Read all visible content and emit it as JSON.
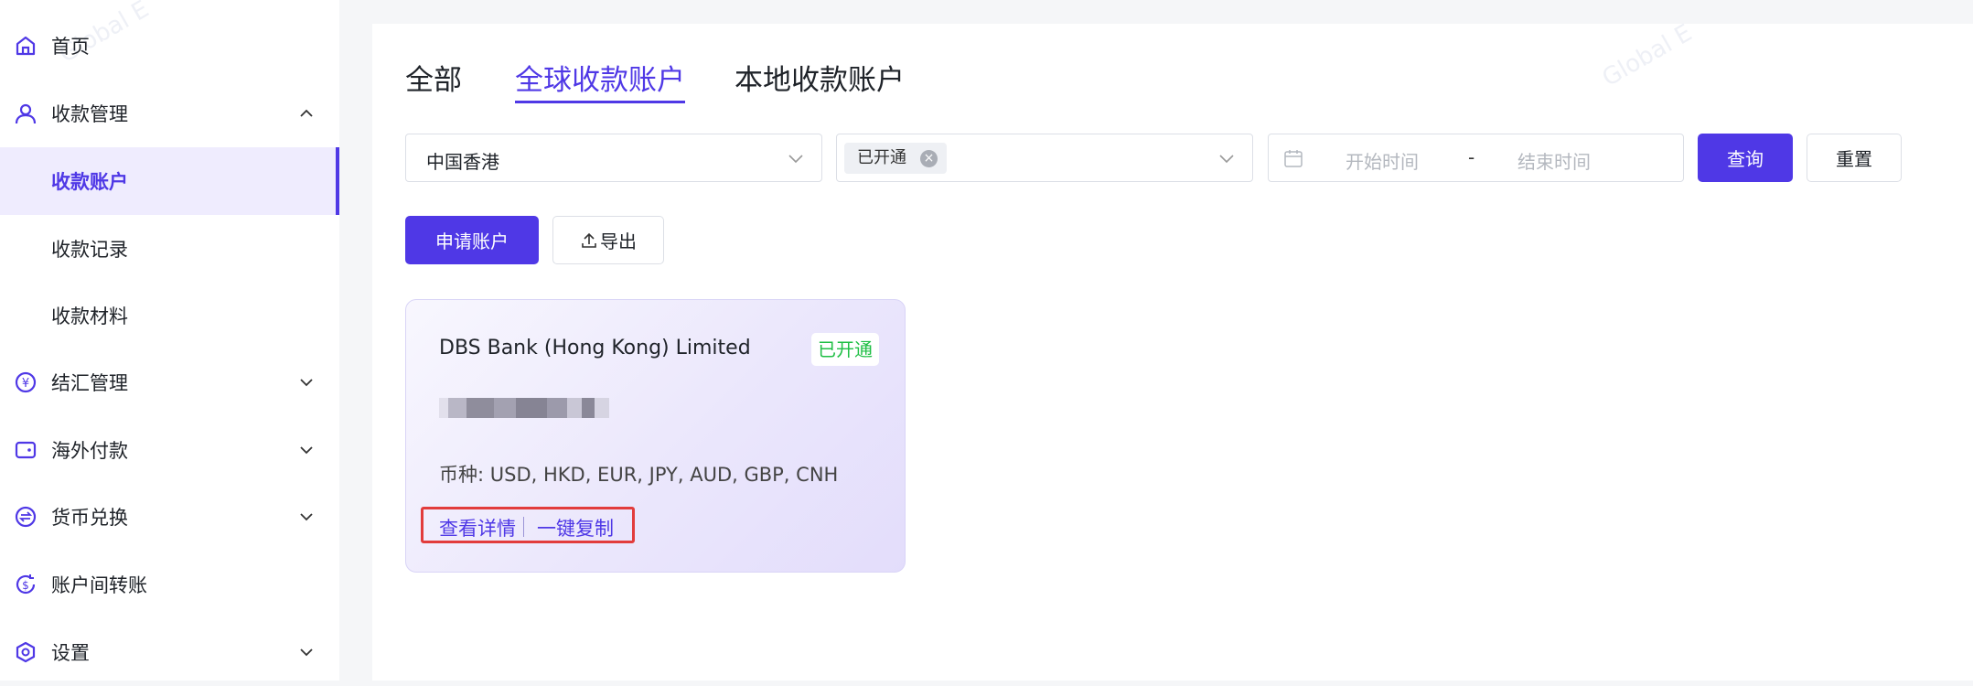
{
  "sidebar": {
    "items": [
      {
        "label": "首页",
        "icon": "home-icon"
      },
      {
        "label": "收款管理",
        "icon": "user-icon",
        "expanded": true
      },
      {
        "label": "收款账户",
        "active": true
      },
      {
        "label": "收款记录"
      },
      {
        "label": "收款材料"
      },
      {
        "label": "结汇管理",
        "icon": "yen-circle-icon"
      },
      {
        "label": "海外付款",
        "icon": "wallet-icon"
      },
      {
        "label": "货币兑换",
        "icon": "exchange-icon"
      },
      {
        "label": "账户间转账",
        "icon": "dollar-transfer-icon"
      },
      {
        "label": "设置",
        "icon": "settings-hex-icon"
      }
    ]
  },
  "tabs": [
    {
      "label": "全部"
    },
    {
      "label": "全球收款账户",
      "active": true
    },
    {
      "label": "本地收款账户"
    }
  ],
  "filters": {
    "region_value": "中国香港",
    "status_tag": "已开通",
    "start_placeholder": "开始时间",
    "separator": "-",
    "end_placeholder": "结束时间",
    "query_label": "查询",
    "reset_label": "重置"
  },
  "actions": {
    "apply_label": "申请账户",
    "export_label": "导出"
  },
  "account_card": {
    "bank_name": "DBS Bank (Hong Kong) Limited",
    "status": "已开通",
    "currency": "币种: USD, HKD, EUR, JPY, AUD, GBP, CNH",
    "view_details": "查看详情",
    "copy": "一键复制"
  },
  "watermark": "Global E",
  "colors": {
    "accent": "#4f38e6",
    "active_bg": "#efecfe",
    "status_green": "#1fbf45",
    "highlight_red": "#e23c3c"
  }
}
